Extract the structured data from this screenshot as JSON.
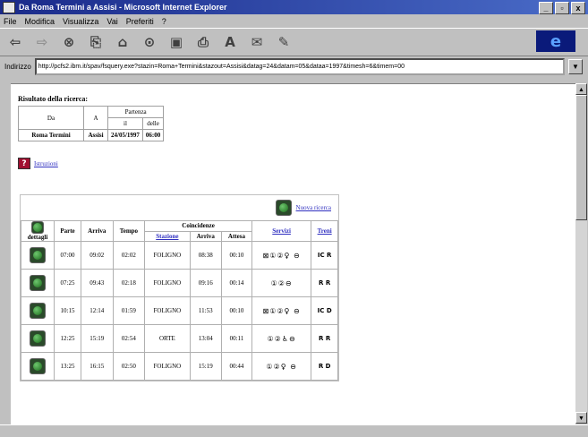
{
  "window": {
    "title": "Da Roma Termini a Assisi - Microsoft Internet Explorer",
    "controls": [
      "_",
      "▫",
      "x"
    ]
  },
  "menu": [
    "File",
    "Modifica",
    "Visualizza",
    "Vai",
    "Preferiti",
    "?"
  ],
  "toolbar": {
    "icons": [
      "back-icon",
      "forward-icon",
      "stop-icon",
      "refresh-icon",
      "home-icon",
      "search-icon",
      "favorites-icon",
      "print-icon",
      "font-icon",
      "mail-icon",
      "edit-icon"
    ]
  },
  "address": {
    "label": "Indirizzo",
    "url": "http://pcfs2.ibm.it/spav/fsquery.exe?stazin=Roma+Termini&stazout=Assisi&datag=24&datam=05&dataa=1997&timesh=6&timem=00"
  },
  "summary": {
    "heading": "Risultato della ricerca:",
    "headers": {
      "da": "Da",
      "a": "A",
      "partenza": "Partenza",
      "il": "il",
      "dalle": "delle"
    },
    "row": {
      "da": "Roma Termini",
      "a": "Assisi",
      "il": "24/05/1997",
      "dalle": "06:00"
    }
  },
  "istruzioni": "Istruzioni",
  "nuova_ricerca": "Nuova ricerca",
  "table": {
    "headers": {
      "dettagli": "dettagli",
      "parte": "Parte",
      "arriva": "Arriva",
      "tempo": "Tempo",
      "coincidenze": "Coincidenze",
      "stazione": "Stazione",
      "arriva2": "Arriva",
      "attesa": "Attesa",
      "servizi": "Servizi",
      "treni": "Treni"
    },
    "rows": [
      {
        "parte": "07:00",
        "arriva": "09:02",
        "tempo": "02:02",
        "stazione": "FOLIGNO",
        "arriva2": "08:38",
        "attesa": "00:10",
        "servizi": "⊠①②♀ ⊖",
        "treni": "IC R"
      },
      {
        "parte": "07:25",
        "arriva": "09:43",
        "tempo": "02:18",
        "stazione": "FOLIGNO",
        "arriva2": "09:16",
        "attesa": "00:14",
        "servizi": "①②⊖",
        "treni": "R R"
      },
      {
        "parte": "10:15",
        "arriva": "12:14",
        "tempo": "01:59",
        "stazione": "FOLIGNO",
        "arriva2": "11:53",
        "attesa": "00:10",
        "servizi": "⊠①②♀ ⊖",
        "treni": "IC D"
      },
      {
        "parte": "12:25",
        "arriva": "15:19",
        "tempo": "02:54",
        "stazione": "ORTE",
        "arriva2": "13:04",
        "attesa": "00:11",
        "servizi": "①②♿⊖",
        "treni": "R R"
      },
      {
        "parte": "13:25",
        "arriva": "16:15",
        "tempo": "02:50",
        "stazione": "FOLIGNO",
        "arriva2": "15:19",
        "attesa": "00:44",
        "servizi": "①②♀ ⊖",
        "treni": "R D"
      }
    ]
  }
}
